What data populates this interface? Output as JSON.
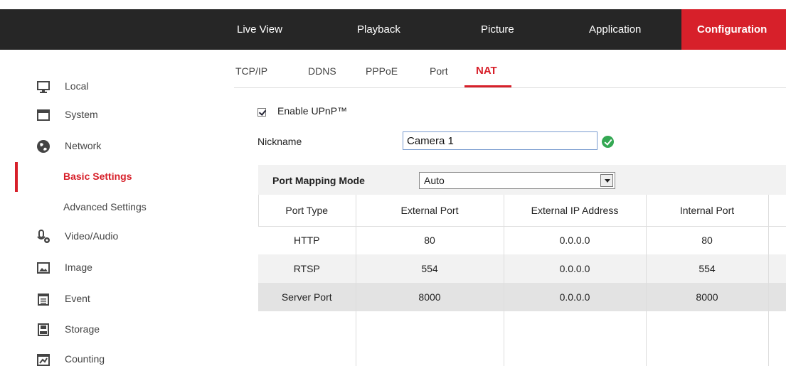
{
  "topnav": {
    "items": [
      "Live View",
      "Playback",
      "Picture",
      "Application",
      "Configuration"
    ],
    "active": "Configuration"
  },
  "sidebar": {
    "items": [
      {
        "label": "Local",
        "icon": "monitor-icon"
      },
      {
        "label": "System",
        "icon": "window-icon"
      },
      {
        "label": "Network",
        "icon": "globe-icon"
      },
      {
        "label": "Basic Settings",
        "icon": ""
      },
      {
        "label": "Advanced Settings",
        "icon": ""
      },
      {
        "label": "Video/Audio",
        "icon": "mic-icon"
      },
      {
        "label": "Image",
        "icon": "image-icon"
      },
      {
        "label": "Event",
        "icon": "calendar-icon"
      },
      {
        "label": "Storage",
        "icon": "disk-icon"
      },
      {
        "label": "Counting",
        "icon": "chart-icon"
      }
    ],
    "selected": "Basic Settings"
  },
  "tabs": {
    "items": [
      "TCP/IP",
      "DDNS",
      "PPPoE",
      "Port",
      "NAT"
    ],
    "active": "NAT"
  },
  "upnp": {
    "label": "Enable UPnP™",
    "checked": true
  },
  "nickname": {
    "label": "Nickname",
    "value": "Camera 1"
  },
  "port_mapping": {
    "label": "Port Mapping Mode",
    "value": "Auto"
  },
  "table": {
    "headers": [
      "Port Type",
      "External Port",
      "External IP Address",
      "Internal Port"
    ],
    "rows": [
      [
        "HTTP",
        "80",
        "0.0.0.0",
        "80"
      ],
      [
        "RTSP",
        "554",
        "0.0.0.0",
        "554"
      ],
      [
        "Server Port",
        "8000",
        "0.0.0.0",
        "8000"
      ]
    ]
  },
  "colors": {
    "accent": "#d7202a",
    "topbar": "#262626"
  }
}
